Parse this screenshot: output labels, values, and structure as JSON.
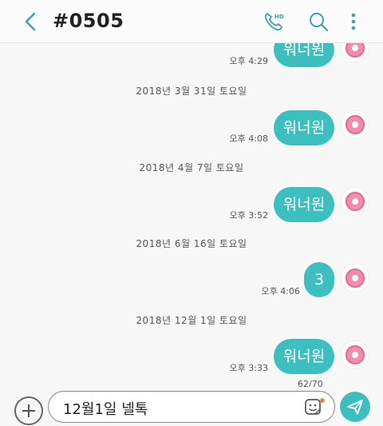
{
  "header": {
    "title": "#0505",
    "back_icon": "back-chevron-icon",
    "call_icon": "hd-call-icon",
    "search_icon": "search-icon",
    "more_icon": "more-vertical-icon",
    "hd_label": "HD"
  },
  "messages": [
    {
      "text": "워너원",
      "time": "오후 4:29"
    },
    {
      "date": "2018년 3월 31일 토요일"
    },
    {
      "text": "워너원",
      "time": "오후 4:08"
    },
    {
      "date": "2018년 4월 7일 토요일"
    },
    {
      "text": "워너원",
      "time": "오후 3:52"
    },
    {
      "date": "2018년 6월 16일 토요일"
    },
    {
      "text": "3",
      "time": "오후 4:06"
    },
    {
      "date": "2018년 12월 1일 토요일"
    },
    {
      "text": "워너원",
      "time": "오후 3:33"
    }
  ],
  "composer": {
    "char_count": "62/70",
    "input_value": "12월1일 넬톡",
    "add_icon": "plus-circle-icon",
    "sticker_icon": "sticker-icon",
    "send_icon": "send-icon"
  },
  "colors": {
    "accent": "#3ebfbf",
    "background": "#f7f7f7"
  }
}
